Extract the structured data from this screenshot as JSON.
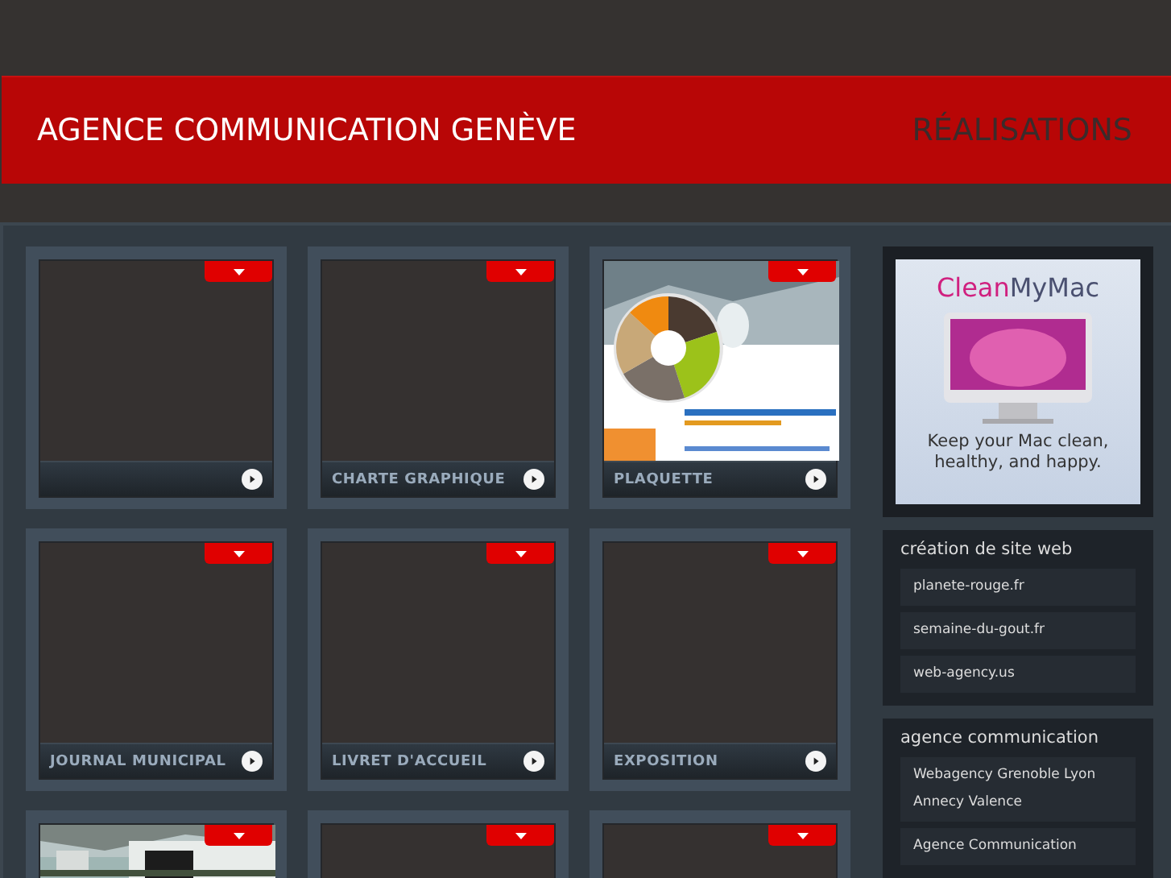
{
  "header": {
    "title": "AGENCE COMMUNICATION GENÈVE",
    "section": "RÉALISATIONS"
  },
  "cards": [
    {
      "kind": "blank"
    },
    {
      "kind": "blank",
      "label": "CHARTE GRAPHIQUE"
    },
    {
      "kind": "picture",
      "label": "PLAQUETTE"
    },
    {
      "kind": "blank",
      "label": "JOURNAL MUNICIPAL"
    },
    {
      "kind": "blank",
      "label": "LIVRET D'ACCUEIL"
    },
    {
      "kind": "blank",
      "label": "EXPOSITION"
    },
    {
      "kind": "picture",
      "cut_off": true
    },
    {
      "kind": "blank",
      "cut_off": true
    },
    {
      "kind": "blank",
      "cut_off": true
    }
  ],
  "ad": {
    "brand_start": "Clean",
    "brand_end": "MyMac",
    "tagline": "Keep your Mac clean, healthy, and happy."
  },
  "sidebar": [
    {
      "title": "création de site web",
      "links": [
        "planete-rouge.fr",
        "semaine-du-gout.fr",
        "web-agency.us"
      ]
    },
    {
      "title": "agence communication",
      "links": [
        "Webagency Grenoble Lyon Annecy Valence",
        "Agence Communication"
      ]
    }
  ]
}
